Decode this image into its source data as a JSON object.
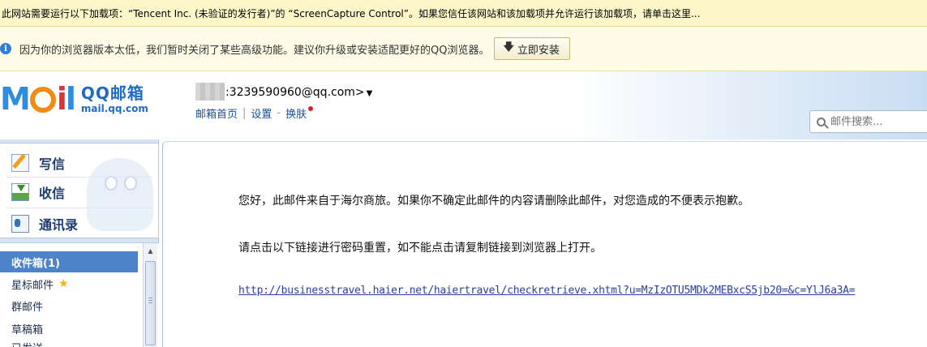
{
  "ie_infobar": {
    "text": "此网站需要运行以下加载项：“Tencent Inc. (未验证的发行者)”的 “ScreenCapture Control”。如果您信任该网站和该加载项并允许运行该加载项，请单击这里..."
  },
  "qq_notice": {
    "text": "因为你的浏览器版本太低，我们暂时关闭了某些高级功能。建议你升级或安装适配更好的QQ浏览器。",
    "install_label": "立即安装"
  },
  "header": {
    "logo_cn": "QQ邮箱",
    "logo_url": "mail.qq.com",
    "account": ":3239590960@qq.com>",
    "nav": {
      "home": "邮箱首页",
      "settings": "设置",
      "sep": "-",
      "skin": "换肤"
    },
    "search_placeholder": "邮件搜索..."
  },
  "sidebar": {
    "actions": {
      "compose": "写信",
      "inbox": "收信",
      "contacts": "通讯录"
    },
    "folders": [
      {
        "label": "收件箱(1)",
        "active": true
      },
      {
        "label": "星标邮件",
        "star": true
      },
      {
        "label": "群邮件"
      },
      {
        "label": "草稿箱"
      },
      {
        "label": "已发送"
      }
    ]
  },
  "message": {
    "greeting": "您好，此邮件来自于海尔商旅。如果你不确定此邮件的内容请删除此邮件，对您造成的不便表示抱歉。",
    "instruction": "请点击以下链接进行密码重置，如不能点击请复制链接到浏览器上打开。",
    "link": "http://businesstravel.haier.net/haiertravel/checkretrieve.xhtml?u=MzIzOTU5MDk2MEBxcS5jb20=&c=YlJ6a3A="
  },
  "colors": {
    "ie_bar_bg": "#fdf6c8",
    "active_folder_bg": "#4d84c9",
    "link": "#2b3f9e"
  }
}
